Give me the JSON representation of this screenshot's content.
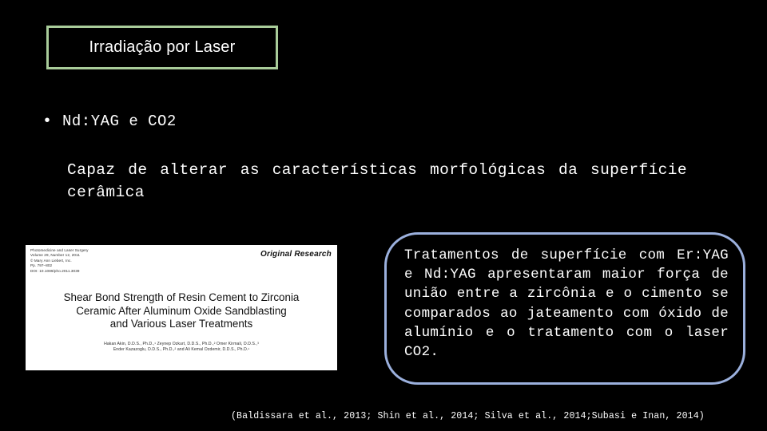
{
  "slide": {
    "background_color": "#000000",
    "title_box": {
      "label": "Irradiação por Laser",
      "border_color": "#a9cc9a"
    },
    "bullet": {
      "marker": "•",
      "text": "Nd:YAG e CO2"
    },
    "sub_paragraph": "Capaz de alterar as características morfológicas da superfície cerâmica",
    "journal_thumbnail": {
      "meta": "Photomedicine and Laser Surgery\nVolume 29, Number 12, 2011\n© Mary Ann Liebert, Inc.\nPp. 797–802\nDOI: 10.1089/pho.2011.3039",
      "kind": "Original Research",
      "title": "Shear Bond Strength of Resin Cement to Zirconia\nCeramic After Aluminum Oxide Sandblasting\nand Various Laser Treatments",
      "authors": "Hakan Akin, D.D.S., Ph.D.,¹ Zeynep Ozkurt, D.D.S., Ph.D.,² Omer Kirmali, D.D.S.,³\nEnder Kazazoglu, D.D.S., Ph.D.,² and Ali Kemal Ozdemir, D.D.S., Ph.D.¹"
    },
    "callout": {
      "text": "Tratamentos de superfície com Er:YAG e Nd:YAG apresentaram maior força de união entre a zircônia e o cimento se comparados ao jateamento com óxido de alumínio e o tratamento com o laser CO2.",
      "border_color": "#9bb0dd"
    },
    "citation": "(Baldissara et al., 2013; Shin et al., 2014; Silva et al., 2014;Subasi e Inan, 2014)"
  }
}
